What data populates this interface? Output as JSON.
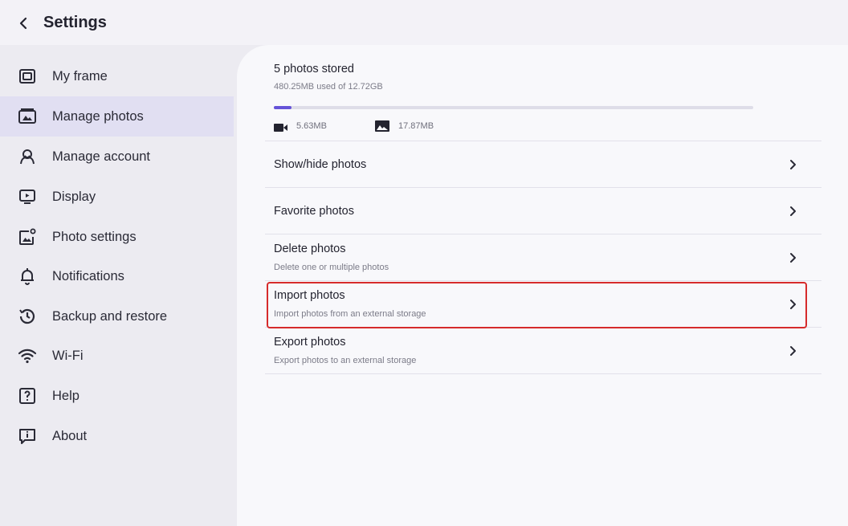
{
  "header": {
    "title": "Settings",
    "back_icon": "chevron-left-icon"
  },
  "sidebar": {
    "items": [
      {
        "label": "My frame",
        "icon": "frame-icon",
        "active": false
      },
      {
        "label": "Manage photos",
        "icon": "photos-icon",
        "active": true
      },
      {
        "label": "Manage account",
        "icon": "account-icon",
        "active": false
      },
      {
        "label": "Display",
        "icon": "display-icon",
        "active": false
      },
      {
        "label": "Photo settings",
        "icon": "photo-settings-icon",
        "active": false
      },
      {
        "label": "Notifications",
        "icon": "bell-icon",
        "active": false
      },
      {
        "label": "Backup and restore",
        "icon": "backup-icon",
        "active": false
      },
      {
        "label": "Wi-Fi",
        "icon": "wifi-icon",
        "active": false
      },
      {
        "label": "Help",
        "icon": "help-icon",
        "active": false
      },
      {
        "label": "About",
        "icon": "about-icon",
        "active": false
      }
    ]
  },
  "storage": {
    "title": "5 photos stored",
    "usage": "480.25MB used of 12.72GB",
    "progress_fraction": 0.037,
    "video_size": "5.63MB",
    "photo_size": "17.87MB"
  },
  "rows": [
    {
      "title": "Show/hide photos",
      "subtitle": ""
    },
    {
      "title": "Favorite photos",
      "subtitle": ""
    },
    {
      "title": "Delete photos",
      "subtitle": "Delete one or multiple photos"
    },
    {
      "title": "Import photos",
      "subtitle": "Import photos from an external storage"
    },
    {
      "title": "Export photos",
      "subtitle": "Export photos to an external storage"
    }
  ],
  "colors": {
    "accent": "#6553d8",
    "active_bg": "#e1dff2",
    "highlight": "#d62b2b"
  }
}
